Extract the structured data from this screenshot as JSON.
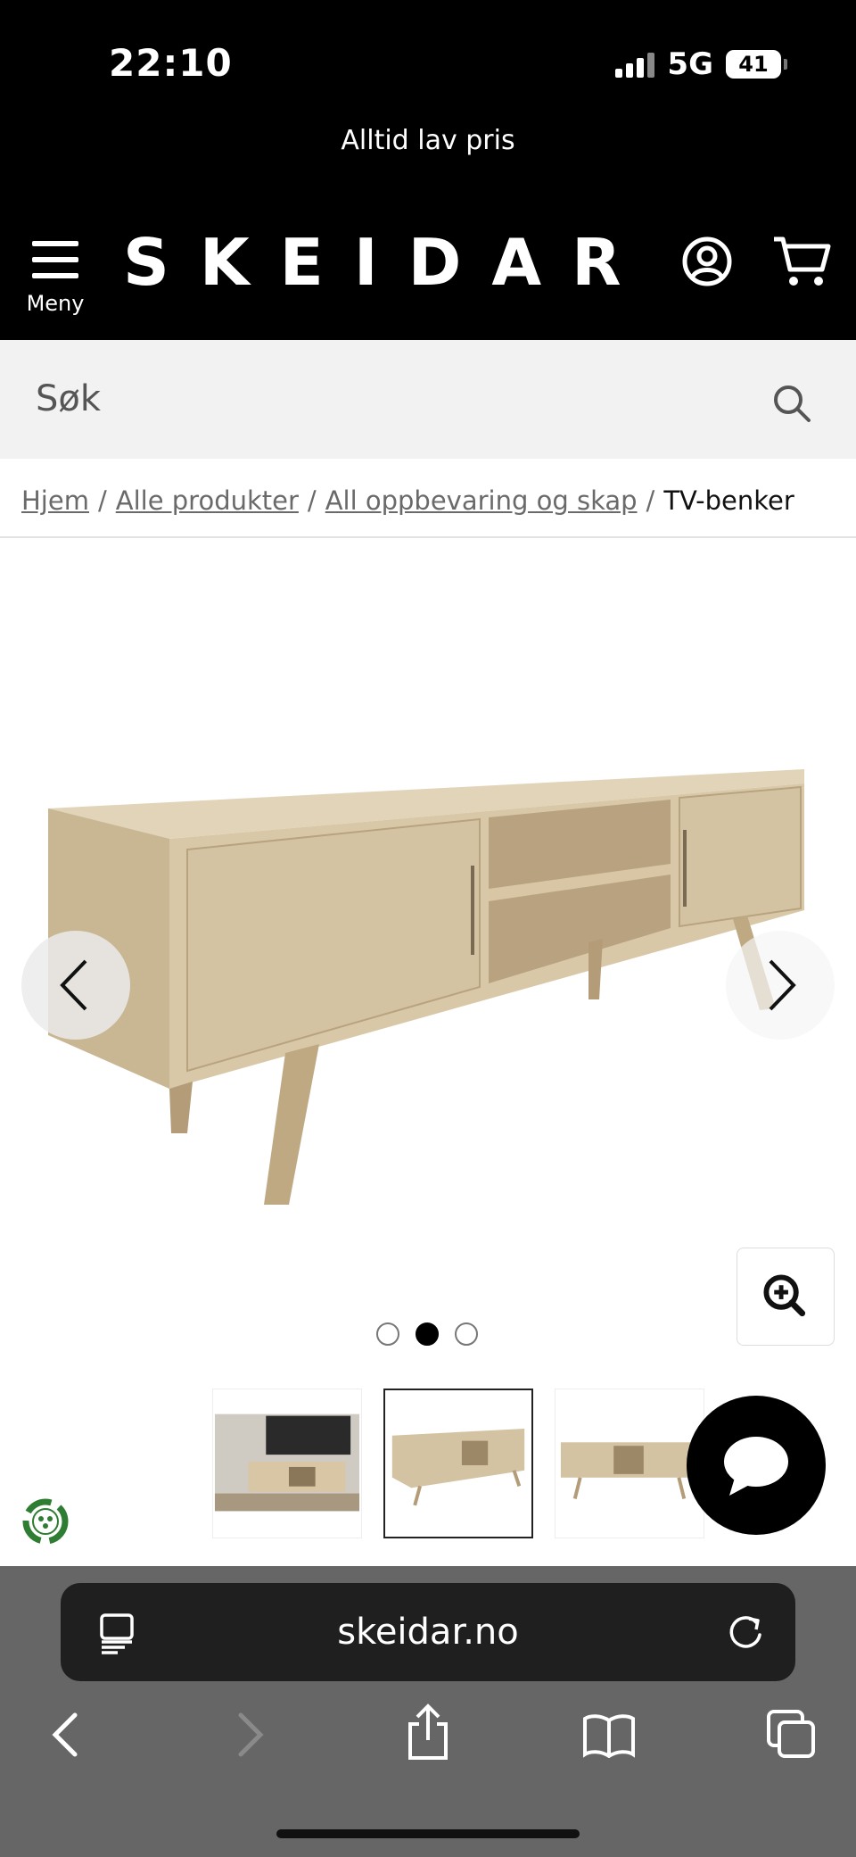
{
  "status_bar": {
    "time": "22:10",
    "network": "5G",
    "battery": "41"
  },
  "promo": {
    "text": "Alltid lav pris"
  },
  "header": {
    "logo": "SKEIDAR",
    "menu_label": "Meny"
  },
  "search": {
    "placeholder": "Søk"
  },
  "breadcrumb": {
    "items": [
      "Hjem",
      "Alle produkter",
      "All oppbevaring og skap"
    ],
    "current": "TV-benker",
    "separator": "/"
  },
  "gallery": {
    "slide_count": 3,
    "active_slide": 2,
    "thumbnail_count": 3,
    "active_thumbnail": 2
  },
  "browser": {
    "url": "skeidar.no"
  },
  "colors": {
    "header_bg": "#000000",
    "wood": "#d8c8aa",
    "search_bg": "#f2f2f2",
    "browser_bg": "#666666"
  },
  "icons": [
    "hamburger-icon",
    "account-icon",
    "cart-icon",
    "search-icon",
    "chevron-left-icon",
    "chevron-right-icon",
    "zoom-in-icon",
    "chat-icon",
    "recycle-icon",
    "tabs-icon",
    "reload-icon",
    "back-icon",
    "forward-icon",
    "share-icon",
    "bookmarks-icon",
    "tab-overview-icon"
  ]
}
